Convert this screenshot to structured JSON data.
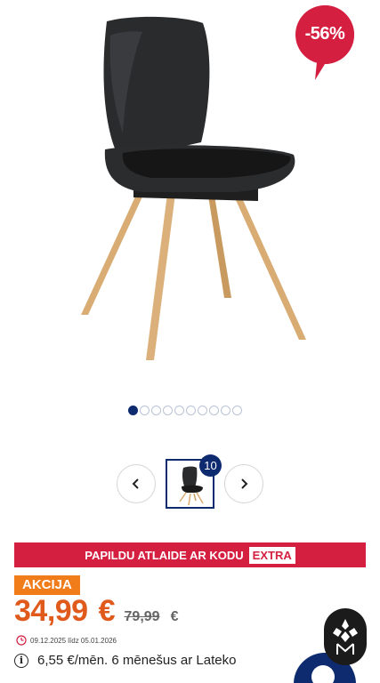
{
  "product": {
    "discount_badge": "-56%",
    "image_alt": "Black chair with wooden legs"
  },
  "gallery": {
    "dot_count": 10,
    "active_dot": 0,
    "thumb_count": "10"
  },
  "promo": {
    "text": "PAPILDU ATLAIDE AR KODU",
    "code": "EXTRA"
  },
  "pricing": {
    "label": "AKCIJA",
    "price": "34,99",
    "currency": "€",
    "old_price": "79,99",
    "old_currency": "€",
    "validity": "09.12.2025 līdz 05.01.2026"
  },
  "installment": {
    "text": "6,55  €/mēn. 6 mēnešus ar Lateko"
  },
  "colors": {
    "brand_red": "#d51f41",
    "navy": "#0d2b6e",
    "orange": "#f07c1a",
    "price_orange": "#e05a1c"
  },
  "icons": [
    "chevron-left-icon",
    "chevron-right-icon",
    "clock-icon",
    "info-icon",
    "brand-logo-icon",
    "chat-icon"
  ]
}
